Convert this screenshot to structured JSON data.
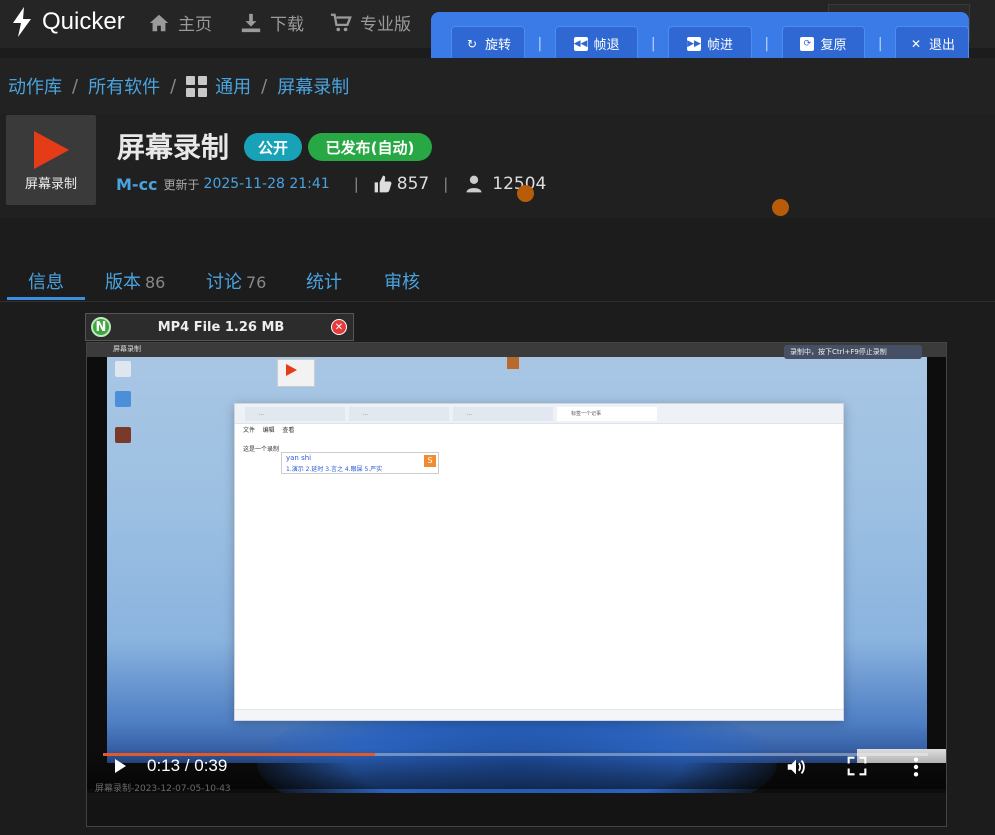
{
  "brand": {
    "name": "Quicker"
  },
  "nav": {
    "home": "主页",
    "download": "下载",
    "pro": "专业版"
  },
  "toolbar": {
    "rotate": "旋转",
    "frame_back": "帧退",
    "frame_forward": "帧进",
    "reset": "复原",
    "exit": "退出",
    "separator": "|"
  },
  "breadcrumb": {
    "items": [
      "动作库",
      "所有软件",
      "通用",
      "屏幕录制"
    ],
    "separator": "/"
  },
  "action": {
    "icon_label": "屏幕录制",
    "title": "屏幕录制",
    "badge_public": "公开",
    "badge_published": "已发布(自动)",
    "author": "M-cc",
    "updated_label": "更新于",
    "updated_at": "2025-11-28 21:41",
    "likes": "857",
    "users": "12504"
  },
  "tabs": {
    "info": "信息",
    "versions": "版本",
    "versions_count": "86",
    "discussion": "讨论",
    "discussion_count": "76",
    "stats": "统计",
    "review": "审核"
  },
  "file": {
    "name": "MP4 File 1.26 MB"
  },
  "video": {
    "current_time": "0:13",
    "duration": "0:39",
    "time_display": "0:13 / 0:39",
    "progress": 0.33,
    "window_title": "屏幕录制",
    "notice": "录制中，按下Ctrl+F9停止录制",
    "notepad_tab": "标签一个记事",
    "notepad_menu": [
      "文件",
      "编辑",
      "查看"
    ],
    "notepad_text": "这是一个录制",
    "ime_pinyin": "yan shi",
    "ime_candidates": "1.演示  2.延时  3.言之  4.眼屎  5.严实",
    "caption": "屏幕录制-2023-12-07-05-10-43"
  },
  "colors": {
    "accent": "#4aa3df",
    "toolbar_bg": "#3b7be8",
    "badge_public": "#17a2b8",
    "badge_published": "#28a745",
    "play_red": "#e63b17"
  }
}
